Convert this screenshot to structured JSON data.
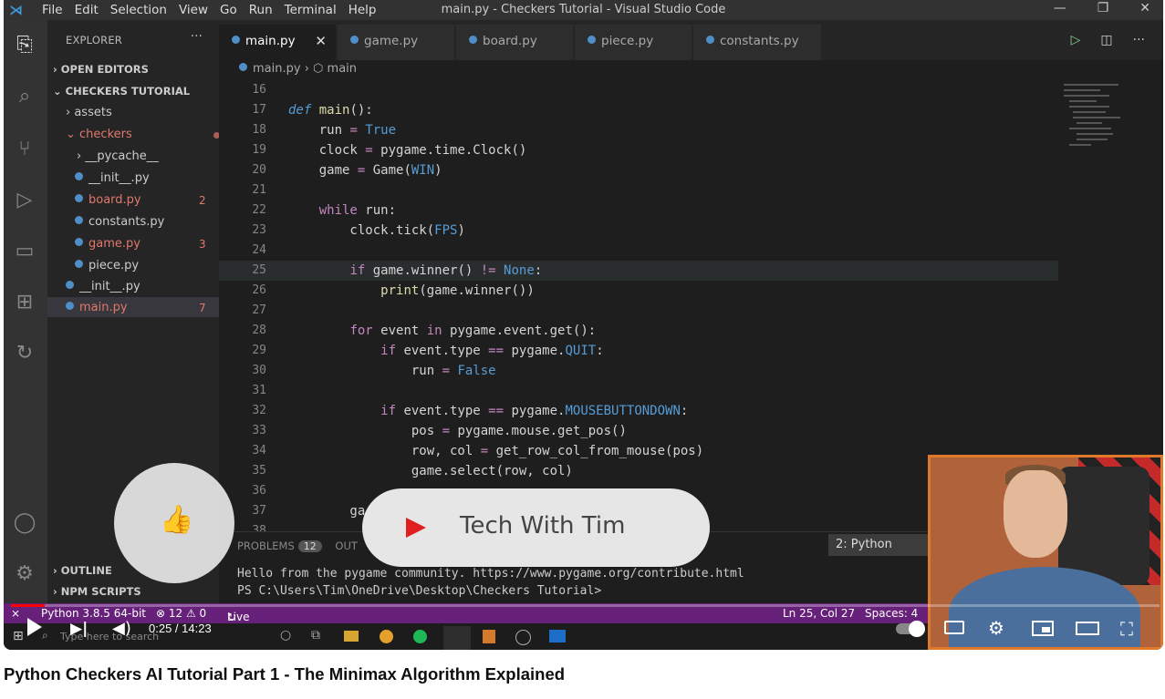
{
  "vscode": {
    "menu": [
      "File",
      "Edit",
      "Selection",
      "View",
      "Go",
      "Run",
      "Terminal",
      "Help"
    ],
    "window_title": "main.py - Checkers Tutorial - Visual Studio Code",
    "explorer": {
      "header": "EXPLORER",
      "open_editors": "OPEN EDITORS",
      "project": "CHECKERS TUTORIAL",
      "items": [
        {
          "label": "assets",
          "badge": ""
        },
        {
          "label": "checkers",
          "badge": ""
        },
        {
          "label": "__pycache__",
          "badge": ""
        },
        {
          "label": "__init__.py",
          "badge": ""
        },
        {
          "label": "board.py",
          "badge": "2"
        },
        {
          "label": "constants.py",
          "badge": ""
        },
        {
          "label": "game.py",
          "badge": "3"
        },
        {
          "label": "piece.py",
          "badge": ""
        },
        {
          "label": "__init__.py",
          "badge": ""
        },
        {
          "label": "main.py",
          "badge": "7"
        }
      ],
      "outline": "OUTLINE",
      "npm_scripts": "NPM SCRIPTS"
    },
    "tabs": [
      "main.py",
      "game.py",
      "board.py",
      "piece.py",
      "constants.py"
    ],
    "breadcrumb": {
      "file": "main.py",
      "symbol": "main"
    },
    "line_numbers": [
      "16",
      "17",
      "18",
      "19",
      "20",
      "21",
      "22",
      "23",
      "24",
      "25",
      "26",
      "27",
      "28",
      "29",
      "30",
      "31",
      "32",
      "33",
      "34",
      "35",
      "36",
      "37",
      "38"
    ],
    "panel": {
      "problems_label": "PROBLEMS",
      "problems_count": "12",
      "output_label": "OUT",
      "terminal_select": "2: Python",
      "terminal_lines": [
        "Hello from the pygame community. https://www.pygame.org/contribute.html",
        "PS C:\\Users\\Tim\\OneDrive\\Desktop\\Checkers Tutorial>"
      ]
    },
    "status": {
      "python": "Python 3.8.5 64-bit",
      "errors": "⊗ 12 ⚠ 0",
      "liveshare": "Live Share",
      "position": "Ln 25, Col 27",
      "spaces": "Spaces: 4"
    },
    "taskbar_search": "Type here to search"
  },
  "overlay": {
    "channel_name": "Tech With Tim"
  },
  "player": {
    "time": "0:25 / 14:23",
    "progress": 0.029
  },
  "video_title": "Python Checkers AI Tutorial Part 1 - The Minimax Algorithm Explained"
}
